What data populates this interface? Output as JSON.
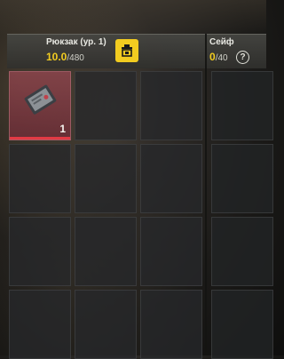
{
  "backpack": {
    "title": "Рюкзак (ур. 1)",
    "capacity_current": "10.0",
    "capacity_max": "/480",
    "sort_icon": "sort-icon"
  },
  "safe": {
    "title": "Сейф",
    "capacity_current": "0",
    "capacity_max": "/40",
    "help_label": "?"
  },
  "items": [
    {
      "icon": "item-document-icon",
      "quantity": "1"
    }
  ],
  "colors": {
    "accent": "#f2cc20",
    "item_rarity_red": "#e23a44"
  }
}
